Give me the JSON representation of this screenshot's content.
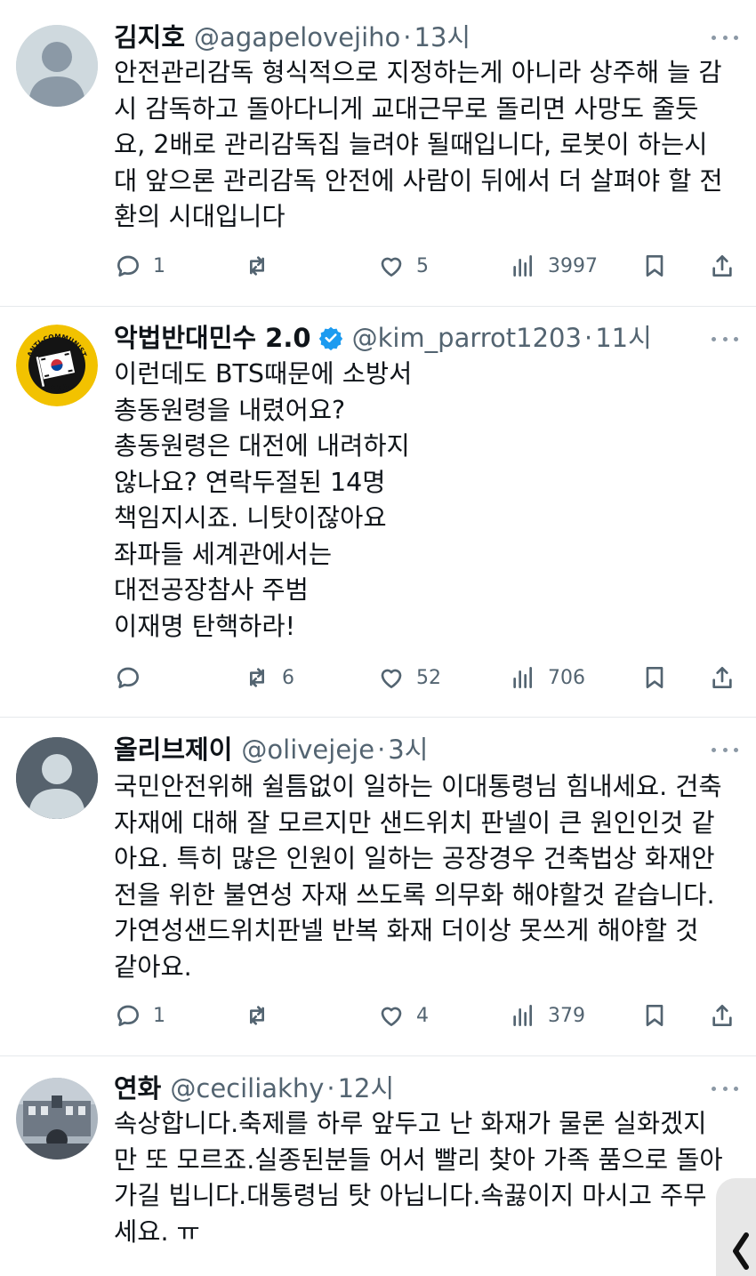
{
  "tweets": [
    {
      "name": "김지호",
      "handle": "@agapelovejiho",
      "sep": "·",
      "time": "13시",
      "text": "안전관리감독 형식적으로 지정하는게 아니라 상주해 늘 감\n시 감독하고 돌아다니게 교대근무로 돌리면 사망도 줄듯\n요, 2배로 관리감독집 늘려야 될때입니다, 로봇이 하는시\n대 앞으론 관리감독 안전에 사람이 뒤에서 더 살펴야 할 전\n환의 시대입니다",
      "replies": "1",
      "retweets": "",
      "likes": "5",
      "views": "3997"
    },
    {
      "name": "악법반대민수 2.0",
      "handle": "@kim_parrot1203",
      "sep": "·",
      "time": "11시",
      "verified": true,
      "avatar_text_top": "ANTI-COMMUNIST",
      "avatar_text_bottom": "ACTION",
      "text": "이런데도 BTS때문에 소방서\n총동원령을 내렸어요?\n총동원령은 대전에 내려하지\n않나요? 연락두절된 14명\n책임지시죠. 니탓이잖아요\n좌파들 세계관에서는\n대전공장참사 주범\n이재명 탄핵하라!",
      "replies": "",
      "retweets": "6",
      "likes": "52",
      "views": "706"
    },
    {
      "name": "올리브제이",
      "handle": "@olivejeje",
      "sep": "·",
      "time": "3시",
      "text": "국민안전위해 쉴틈없이 일하는 이대통령님 힘내세요. 건축\n자재에 대해 잘 모르지만 샌드위치 판넬이 큰 원인인것 같\n아요. 특히 많은 인원이 일하는 공장경우 건축법상 화재안\n전을 위한 불연성 자재 쓰도록 의무화 해야할것 같습니다.\n가연성샌드위치판넬 반복 화재 더이상 못쓰게 해야할 것\n같아요.",
      "replies": "1",
      "retweets": "",
      "likes": "4",
      "views": "379"
    },
    {
      "name": "연화",
      "handle": "@ceciliakhy",
      "sep": "·",
      "time": "12시",
      "text": "속상합니다.축제를 하루 앞두고 난 화재가 물론 실화겠지\n만 또 모르죠.실종된분들 어서 빨리 찾아 가족 품으로 돌아\n가길 빕니다.대통령님 탓 아닙니다.속끓이지 마시고 주무\n세요. ㅠ"
    }
  ],
  "colors": {
    "text": "#0f1419",
    "secondary": "#536471",
    "verified": "#1d9bf0",
    "divider": "#e6e9ec"
  }
}
